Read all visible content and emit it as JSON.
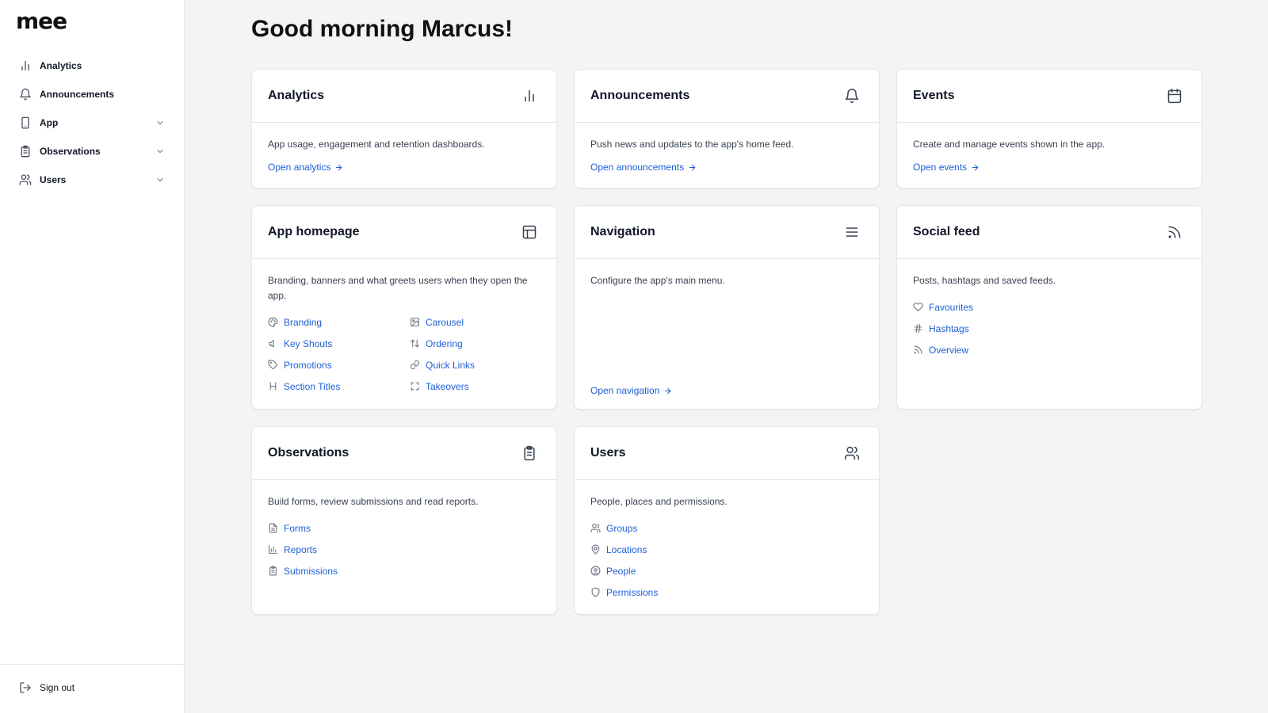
{
  "sidebar": {
    "logo": "mee",
    "items": [
      {
        "label": "Analytics",
        "icon": "bar-chart-icon",
        "expandable": false
      },
      {
        "label": "Announcements",
        "icon": "bell-icon",
        "expandable": false
      },
      {
        "label": "App",
        "icon": "smartphone-icon",
        "expandable": true
      },
      {
        "label": "Observations",
        "icon": "clipboard-icon",
        "expandable": true
      },
      {
        "label": "Users",
        "icon": "users-icon",
        "expandable": true
      }
    ],
    "sign_out": "Sign out"
  },
  "greeting": "Good morning Marcus!",
  "cards": {
    "analytics": {
      "title": "Analytics",
      "description": "App usage, engagement and retention dashboards.",
      "link": "Open analytics",
      "icon": "bar-chart-icon"
    },
    "announcements": {
      "title": "Announcements",
      "description": "Push news and updates to the app's home feed.",
      "link": "Open announcements",
      "icon": "bell-icon"
    },
    "events": {
      "title": "Events",
      "description": "Create and manage events shown in the app.",
      "link": "Open events",
      "icon": "calendar-icon"
    },
    "app_homepage": {
      "title": "App homepage",
      "description": "Branding, banners and what greets users when they open the app.",
      "icon": "layout-icon",
      "links": [
        {
          "label": "Branding",
          "icon": "palette-icon"
        },
        {
          "label": "Carousel",
          "icon": "image-icon"
        },
        {
          "label": "Key Shouts",
          "icon": "megaphone-icon"
        },
        {
          "label": "Ordering",
          "icon": "sort-arrows-icon"
        },
        {
          "label": "Promotions",
          "icon": "tag-icon"
        },
        {
          "label": "Quick Links",
          "icon": "link-icon"
        },
        {
          "label": "Section Titles",
          "icon": "heading-icon"
        },
        {
          "label": "Takeovers",
          "icon": "fullscreen-icon"
        }
      ]
    },
    "navigation": {
      "title": "Navigation",
      "description": "Configure the app's main menu.",
      "link": "Open navigation",
      "icon": "menu-icon"
    },
    "social_feed": {
      "title": "Social feed",
      "description": "Posts, hashtags and saved feeds.",
      "icon": "rss-icon",
      "links": [
        {
          "label": "Favourites",
          "icon": "heart-icon"
        },
        {
          "label": "Hashtags",
          "icon": "hash-icon"
        },
        {
          "label": "Overview",
          "icon": "rss-icon"
        }
      ]
    },
    "observations": {
      "title": "Observations",
      "description": "Build forms, review submissions and read reports.",
      "icon": "clipboard-icon",
      "links": [
        {
          "label": "Forms",
          "icon": "document-icon"
        },
        {
          "label": "Reports",
          "icon": "bar-chart-icon"
        },
        {
          "label": "Submissions",
          "icon": "clipboard-icon"
        }
      ]
    },
    "users": {
      "title": "Users",
      "description": "People, places and permissions.",
      "icon": "users-icon",
      "links": [
        {
          "label": "Groups",
          "icon": "users-icon"
        },
        {
          "label": "Locations",
          "icon": "map-pin-icon"
        },
        {
          "label": "People",
          "icon": "user-circle-icon"
        },
        {
          "label": "Permissions",
          "icon": "shield-icon"
        }
      ]
    }
  },
  "colors": {
    "link": "#1d5fd6",
    "background": "#f3f4f6",
    "card": "#ffffff",
    "border": "#e5e7eb"
  }
}
